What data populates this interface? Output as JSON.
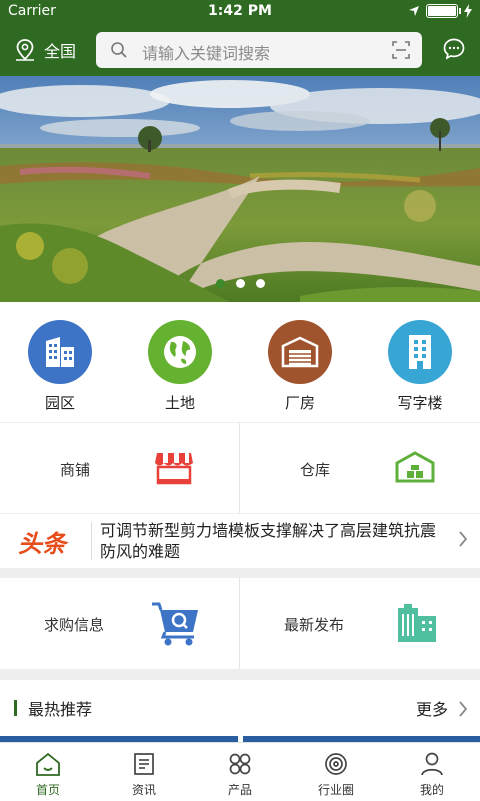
{
  "status_bar": {
    "carrier": "Carrier",
    "time": "1:42 PM"
  },
  "header": {
    "location": "全国",
    "search_placeholder": "请输入关键词搜索"
  },
  "banner": {
    "slide_count": 3,
    "active_slide": 1
  },
  "categories": [
    {
      "label": "园区",
      "icon": "buildings-icon",
      "color": "#3d74c6"
    },
    {
      "label": "土地",
      "icon": "globe-icon",
      "color": "#64b22f"
    },
    {
      "label": "厂房",
      "icon": "garage-icon",
      "color": "#a0542e"
    },
    {
      "label": "写字楼",
      "icon": "office-building-icon",
      "color": "#38a6d4"
    }
  ],
  "shop_row": {
    "shop_label": "商铺",
    "warehouse_label": "仓库"
  },
  "news": {
    "tag": "头条",
    "headline": "可调节新型剪力墙模板支撑解决了高层建筑抗震防风的难题"
  },
  "info_row": {
    "purchase_label": "求购信息",
    "latest_label": "最新发布"
  },
  "hot": {
    "title": "最热推荐",
    "more": "更多"
  },
  "tabs": [
    {
      "label": "首页",
      "icon": "home-icon",
      "active": true
    },
    {
      "label": "资讯",
      "icon": "news-icon"
    },
    {
      "label": "产品",
      "icon": "grid-icon"
    },
    {
      "label": "行业圈",
      "icon": "circle-icon"
    },
    {
      "label": "我的",
      "icon": "user-icon"
    }
  ],
  "colors": {
    "brand_green": "#2f6a22",
    "news_tag": "#e74c1b",
    "accent_blue": "#2a5ea0"
  }
}
